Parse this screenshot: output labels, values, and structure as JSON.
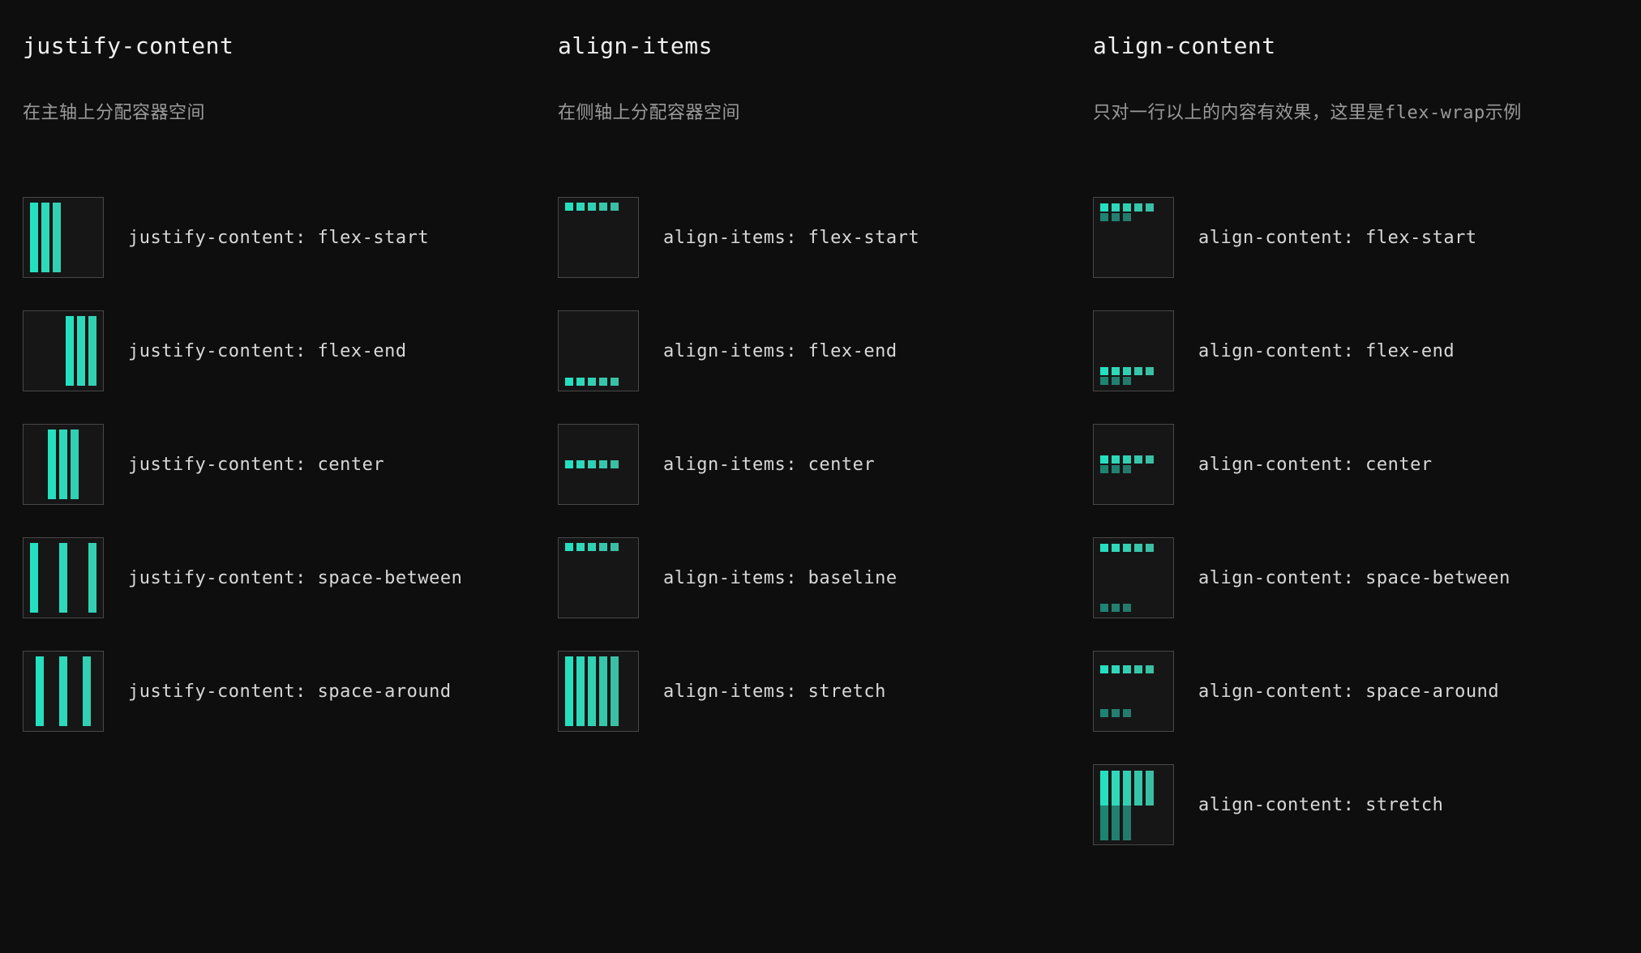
{
  "columns": {
    "justify": {
      "title": "justify-content",
      "desc": "在主轴上分配容器空间",
      "items": [
        {
          "label": "justify-content: flex-start"
        },
        {
          "label": "justify-content: flex-end"
        },
        {
          "label": "justify-content: center"
        },
        {
          "label": "justify-content: space-between"
        },
        {
          "label": "justify-content: space-around"
        }
      ]
    },
    "align_items": {
      "title": "align-items",
      "desc": "在侧轴上分配容器空间",
      "items": [
        {
          "label": "align-items: flex-start"
        },
        {
          "label": "align-items: flex-end"
        },
        {
          "label": "align-items: center"
        },
        {
          "label": "align-items: baseline"
        },
        {
          "label": "align-items: stretch"
        }
      ]
    },
    "align_content": {
      "title": "align-content",
      "desc": "只对一行以上的内容有效果，这里是flex-wrap示例",
      "items": [
        {
          "label": "align-content: flex-start"
        },
        {
          "label": "align-content: flex-end"
        },
        {
          "label": "align-content: center"
        },
        {
          "label": "align-content: space-between"
        },
        {
          "label": "align-content: space-around"
        },
        {
          "label": "align-content: stretch"
        }
      ]
    }
  },
  "colors": {
    "accent": "#24e0c0",
    "bg": "#0e0e0e",
    "border": "#484848"
  }
}
